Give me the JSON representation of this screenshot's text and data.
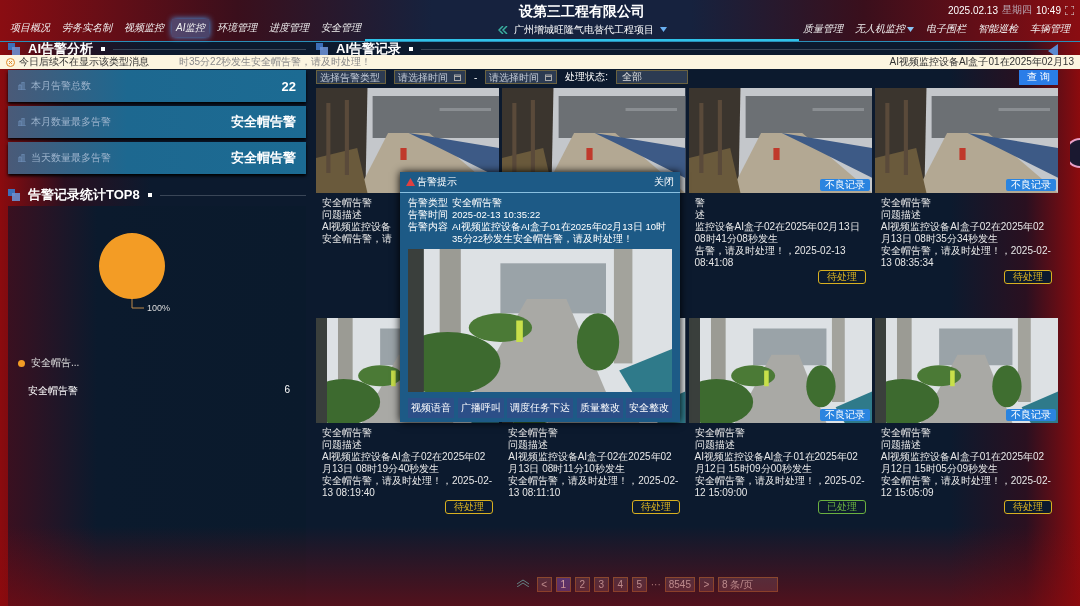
{
  "header": {
    "nav_left": [
      {
        "label": "项目概况",
        "selected": false
      },
      {
        "label": "劳务实名制",
        "selected": false
      },
      {
        "label": "视频监控",
        "selected": false
      },
      {
        "label": "AI监控",
        "selected": true
      },
      {
        "label": "环境管理",
        "selected": false
      },
      {
        "label": "进度管理",
        "selected": false
      },
      {
        "label": "安全管理",
        "selected": false
      }
    ],
    "title": "设第三工程有限公司",
    "subtitle": "广州增城旺隆气电替代工程项目",
    "nav_right": [
      {
        "label": "质量管理",
        "selected": false,
        "dropdown": false
      },
      {
        "label": "无人机监控",
        "selected": false,
        "dropdown": true
      },
      {
        "label": "电子围栏",
        "selected": false,
        "dropdown": false
      },
      {
        "label": "智能巡检",
        "selected": false,
        "dropdown": false
      },
      {
        "label": "车辆管理",
        "selected": false,
        "dropdown": false
      }
    ],
    "date": "2025.02.13",
    "weekday": "星期四",
    "time": "10:49"
  },
  "notice": {
    "dismiss": "今日后续不在显示该类型消息",
    "message": "时35分22秒发生安全帽告警，请及时处理！",
    "next_message": "AI视频监控设备AI盒子01在2025年02月13"
  },
  "analysis": {
    "title": "AI告警分析",
    "stats": [
      {
        "label": "本月告警总数",
        "value": "22"
      },
      {
        "label": "本月数量最多告警",
        "value": "安全帽告警"
      },
      {
        "label": "当天数量最多告警",
        "value": "安全帽告警"
      }
    ]
  },
  "top8": {
    "title": "告警记录统计TOP8",
    "chart_data": {
      "type": "pie",
      "categories": [
        "安全帽告..."
      ],
      "values": [
        100
      ],
      "value_labels": [
        "100%"
      ]
    },
    "rows": [
      {
        "name": "安全帽告警",
        "count": "6"
      }
    ]
  },
  "records": {
    "title": "AI告警记录",
    "filters": {
      "type_placeholder": "选择告警类型",
      "start_placeholder": "请选择时间",
      "separator": "-",
      "end_placeholder": "请选择时间",
      "status_label": "处理状态:",
      "status_value": "全部",
      "search_button": "查 询"
    },
    "cards": [
      {
        "kind": "picture",
        "title": "安全帽告警",
        "label": "问题描述",
        "description": [
          "AI视频监控设备",
          "安全帽告警，请"
        ]
      },
      {
        "kind": "picture"
      },
      {
        "kind": "picture",
        "badge": "不良记录",
        "title": "警",
        "label": "述",
        "description": [
          "监控设备AI盒子02在2025年02月13日 08时41分08秒发生",
          "告警，请及时处理！，2025-02-13 08:41:08"
        ],
        "status": {
          "label": "待处理",
          "kind": "pending"
        }
      },
      {
        "kind": "picture",
        "badge": "不良记录",
        "title": "安全帽告警",
        "label": "问题描述",
        "description": [
          "AI视频监控设备AI盒子02在2025年02月13日 08时35分34秒发生",
          "安全帽告警，请及时处理！，2025-02-13 08:35:34"
        ],
        "status": {
          "label": "待处理",
          "kind": "pending"
        }
      },
      {
        "kind": "picture",
        "title": "安全帽告警",
        "label": "问题描述",
        "description": [
          "AI视频监控设备AI盒子02在2025年02月13日 08时19分40秒发生",
          "安全帽告警，请及时处理！，2025-02-13 08:19:40"
        ],
        "status": {
          "label": "待处理",
          "kind": "pending"
        }
      },
      {
        "kind": "picture",
        "title": "安全帽告警",
        "label": "问题描述",
        "description": [
          "AI视频监控设备AI盒子02在2025年02月13日 08时11分10秒发生",
          "安全帽告警，请及时处理！，2025-02-13 08:11:10"
        ],
        "status": {
          "label": "待处理",
          "kind": "pending"
        }
      },
      {
        "kind": "picture",
        "badge": "不良记录",
        "title": "安全帽告警",
        "label": "问题描述",
        "description": [
          "AI视频监控设备AI盒子01在2025年02月12日 15时09分00秒发生",
          "安全帽告警，请及时处理！，2025-02-12 15:09:00"
        ],
        "status": {
          "label": "已处理",
          "kind": "done"
        }
      },
      {
        "kind": "picture",
        "badge": "不良记录",
        "title": "安全帽告警",
        "label": "问题描述",
        "description": [
          "AI视频监控设备AI盒子01在2025年02月12日 15时05分09秒发生",
          "安全帽告警，请及时处理！，2025-02-12 15:05:09"
        ],
        "status": {
          "label": "待处理",
          "kind": "pending"
        }
      }
    ]
  },
  "pagination": {
    "prev": "<",
    "pages": [
      {
        "label": "1",
        "selected": true
      },
      {
        "label": "2",
        "selected": false
      },
      {
        "label": "3",
        "selected": false
      },
      {
        "label": "4",
        "selected": false
      },
      {
        "label": "5",
        "selected": false
      }
    ],
    "ellipsis": "···",
    "last": "8545",
    "next": ">",
    "page_size": "8 条/页"
  },
  "modal": {
    "title": "告警提示",
    "close": "关闭",
    "fields": [
      {
        "label": "告警类型",
        "value": "安全帽告警"
      },
      {
        "label": "告警时间",
        "value": "2025-02-13 10:35:22"
      },
      {
        "label": "告警内容",
        "value": "AI视频监控设备AI盒子01在2025年02月13日 10时35分22秒发生安全帽告警，请及时处理！"
      }
    ],
    "buttons": [
      "视频语音",
      "广播呼叫",
      "调度任务下达",
      "质量整改",
      "安全整改"
    ]
  }
}
